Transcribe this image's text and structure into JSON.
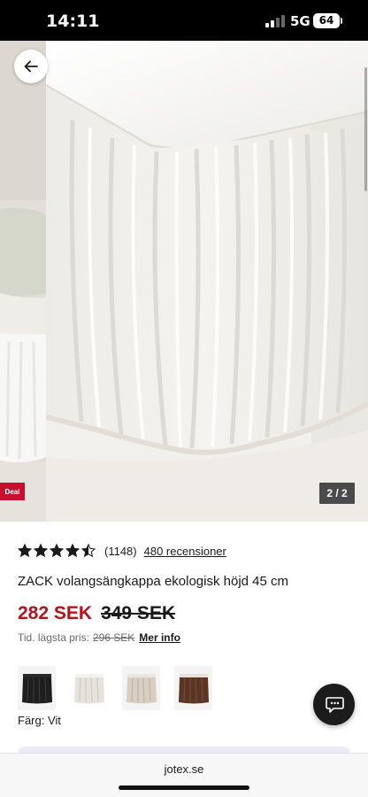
{
  "status_bar": {
    "time": "14:11",
    "network": "5G",
    "battery": "64"
  },
  "gallery": {
    "deal_badge": "Deal",
    "slide_counter": "2 / 2"
  },
  "product": {
    "rating_value": 4.5,
    "rating_count": "(1148)",
    "reviews_link": "480 recensioner",
    "title": "ZACK volangsängkappa ekologisk höjd 45 cm",
    "price_current": "282 SEK",
    "price_old": "349 SEK",
    "lowest_label": "Tid. lägsta pris:",
    "lowest_price": "296 SEK",
    "more_info": "Mer info",
    "color_label": "Färg: Vit",
    "swatches": [
      {
        "name": "black",
        "color": "#1e1e1e"
      },
      {
        "name": "white",
        "color": "#eeeae4"
      },
      {
        "name": "beige",
        "color": "#d8cfc2"
      },
      {
        "name": "brown",
        "color": "#5a3424"
      }
    ]
  },
  "browser": {
    "url": "jotex.se"
  },
  "colors": {
    "accent_red": "#b5121b",
    "deal_red": "#c8102e",
    "dark": "#1c1c1c"
  },
  "icons": [
    "back-arrow-icon",
    "star-icon",
    "chat-icon"
  ]
}
